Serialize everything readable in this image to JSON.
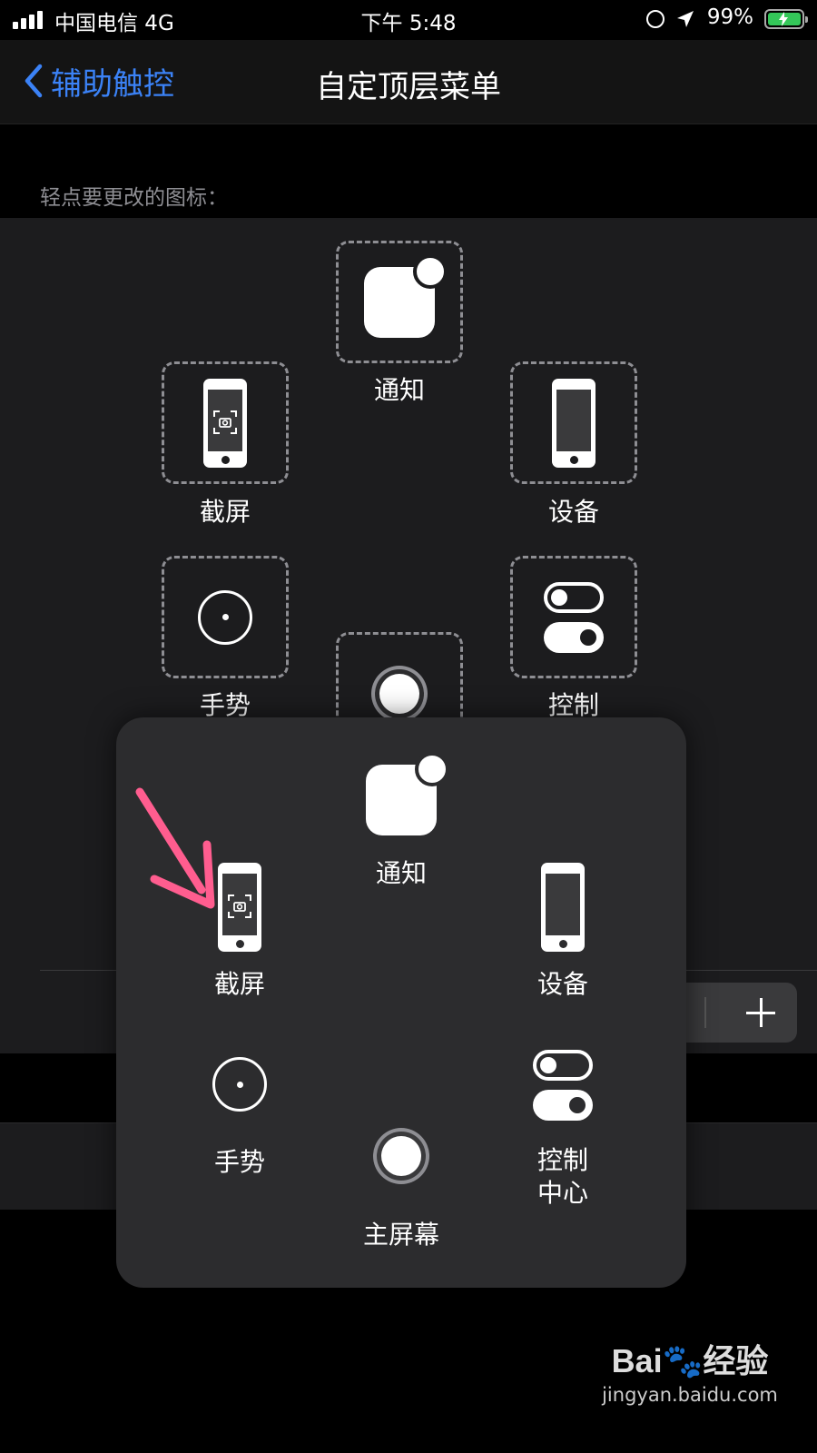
{
  "status_bar": {
    "carrier": "中国电信 4G",
    "time": "下午 5:48",
    "battery": "99%"
  },
  "nav": {
    "back_label": "辅助触控",
    "title": "自定顶层菜单"
  },
  "hint": "轻点要更改的图标：",
  "slots": {
    "notification": "通知",
    "screenshot": "截屏",
    "device": "设备",
    "gesture": "手势",
    "control": "控制"
  },
  "menu": {
    "notification": "通知",
    "screenshot": "截屏",
    "device": "设备",
    "gesture": "手势",
    "control_center": "控制\n中心",
    "home": "主屏幕"
  },
  "watermark": {
    "logo_a": "Bai",
    "logo_b": "经验",
    "url": "jingyan.baidu.com"
  },
  "colors": {
    "accent": "#3b82f6",
    "arrow": "#ff5d8f",
    "battery": "#34c759"
  }
}
